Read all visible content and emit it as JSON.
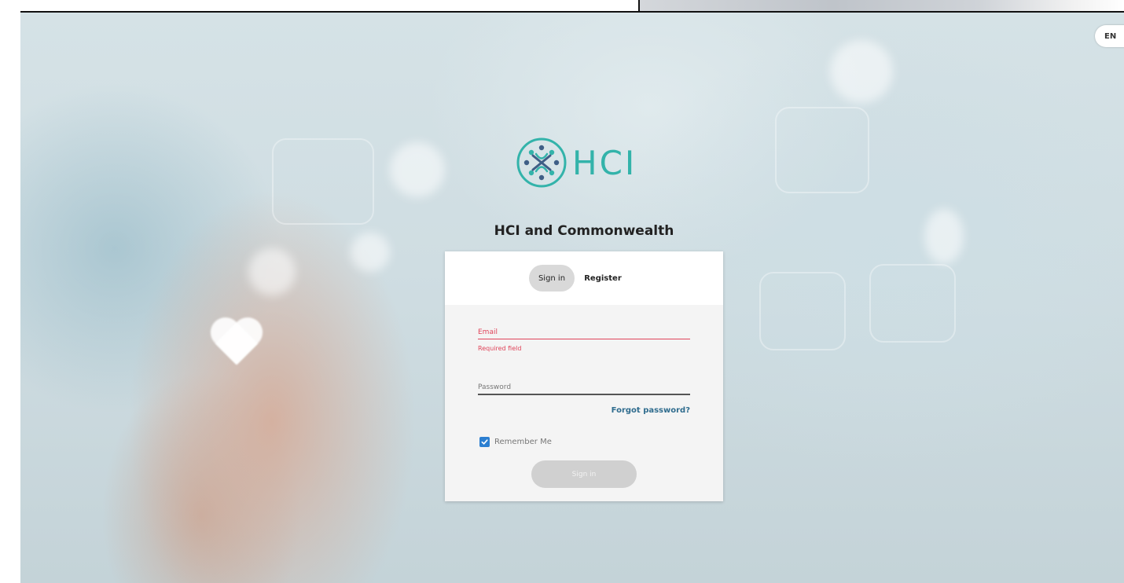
{
  "header": {
    "language": "EN"
  },
  "brand": {
    "logo_text": "HCI",
    "subtitle": "HCI and Commonwealth",
    "logo_color": "#33b3aa"
  },
  "tabs": {
    "signin": "Sign in",
    "register": "Register"
  },
  "form": {
    "email_label": "Email",
    "email_value": "",
    "email_error": "Required field",
    "password_label": "Password",
    "password_value": "",
    "forgot": "Forgot password?",
    "remember": "Remember Me",
    "remember_checked": true,
    "submit": "Sign in"
  },
  "colors": {
    "error": "#e0445a",
    "link": "#2f6c8e",
    "checkbox": "#2c7fd1"
  }
}
